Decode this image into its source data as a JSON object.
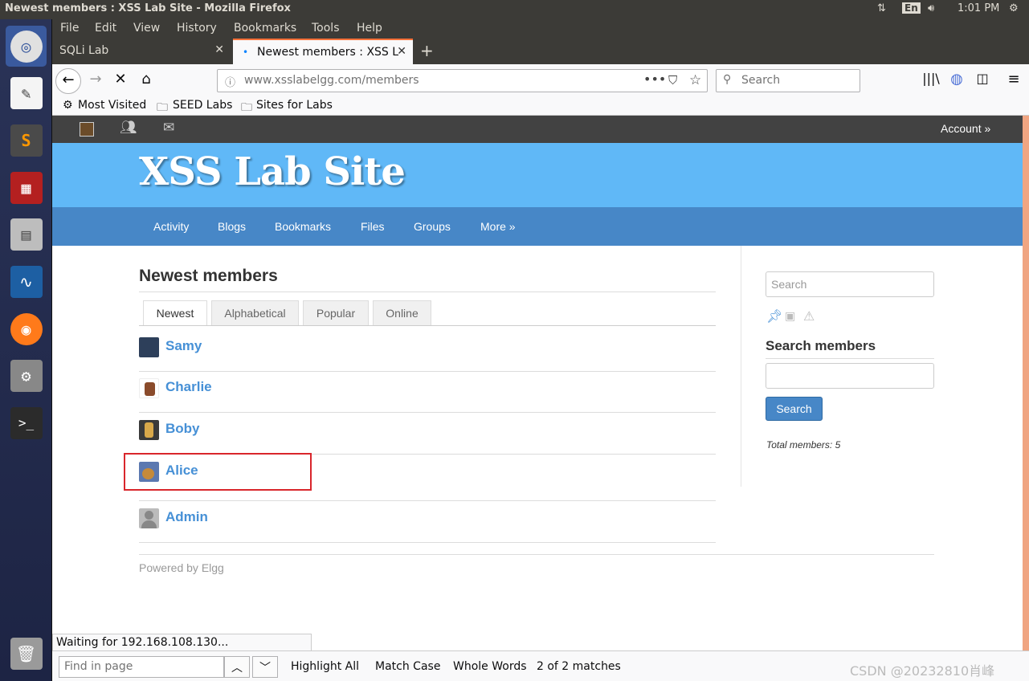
{
  "os": {
    "window_title": "Newest members : XSS Lab Site - Mozilla Firefox",
    "keyboard": "En",
    "time": "1:01 PM"
  },
  "menu": [
    "File",
    "Edit",
    "View",
    "History",
    "Bookmarks",
    "Tools",
    "Help"
  ],
  "tabs": [
    {
      "label": "SQLi Lab",
      "active": false
    },
    {
      "label": "Newest members : XSS L",
      "active": true
    }
  ],
  "url": {
    "host": "www.xsslabelgg.com",
    "path": "/members"
  },
  "browser_search_placeholder": "Search",
  "bookmarks": [
    "Most Visited",
    "SEED Labs",
    "Sites for Labs"
  ],
  "elgg": {
    "account": "Account »",
    "site_title": "XSS Lab Site",
    "nav": [
      "Activity",
      "Blogs",
      "Bookmarks",
      "Files",
      "Groups",
      "More »"
    ],
    "page_title": "Newest members",
    "filter_tabs": [
      "Newest",
      "Alphabetical",
      "Popular",
      "Online"
    ],
    "members": [
      "Samy",
      "Charlie",
      "Boby",
      "Alice",
      "Admin"
    ],
    "sidebar": {
      "search_placeholder": "Search",
      "search_members_heading": "Search members",
      "search_button": "Search",
      "total": "Total members: 5"
    },
    "footer": "Powered by Elgg"
  },
  "status": "Waiting for 192.168.108.130...",
  "findbar": {
    "placeholder": "Find in page",
    "highlight": "Highlight All",
    "match_case": "Match Case",
    "whole_words": "Whole Words",
    "result": "2 of 2 matches"
  },
  "watermark": "CSDN @20232810肖峰",
  "colors": {
    "elgg_header": "#60b8f7",
    "elgg_nav": "#4787c7",
    "link": "#4690d6",
    "highlight_box": "#d9262c"
  }
}
